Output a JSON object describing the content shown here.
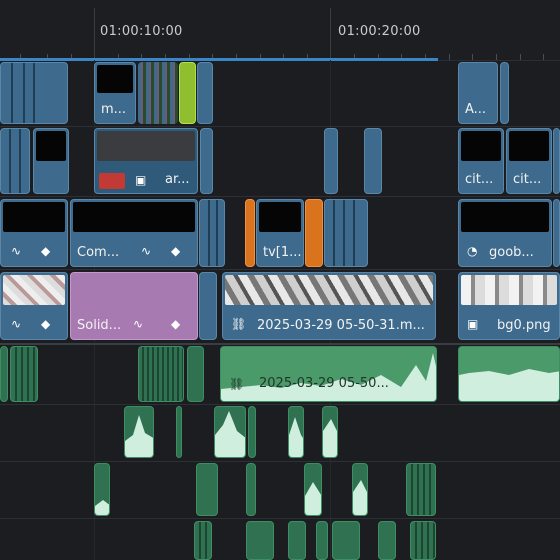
{
  "timeline": {
    "ruler": {
      "timecode_a": "01:00:10:00",
      "timecode_b": "01:00:20:00"
    },
    "video_clip_labels": {
      "v4_clip_a": "m...",
      "v4_clip_b": "A...",
      "v3_clip_a": "ar...",
      "v3_clip_b": "cit...",
      "v3_clip_c": "cit...",
      "v2_clip_a": "Com...",
      "v2_clip_b": "tv[1...",
      "v2_clip_c": "goob...",
      "v1_clip_a": "Solid...",
      "v1_clip_b": "2025-03-29 05-50-31.m...",
      "v1_clip_c": "bg0.png"
    },
    "audio_clip_labels": {
      "a1_clip_a": "2025-03-29 05-50..."
    },
    "colors": {
      "video_clip": "#3e6b8d",
      "solid_clip": "#a77ab1",
      "orange_clip": "#d9731d",
      "audio_clip": "#2f7150",
      "playhead_bar": "#3b86c6"
    },
    "icons": [
      "image-icon",
      "link-icon",
      "curve-icon",
      "keyframe-icon",
      "speed-icon"
    ]
  }
}
